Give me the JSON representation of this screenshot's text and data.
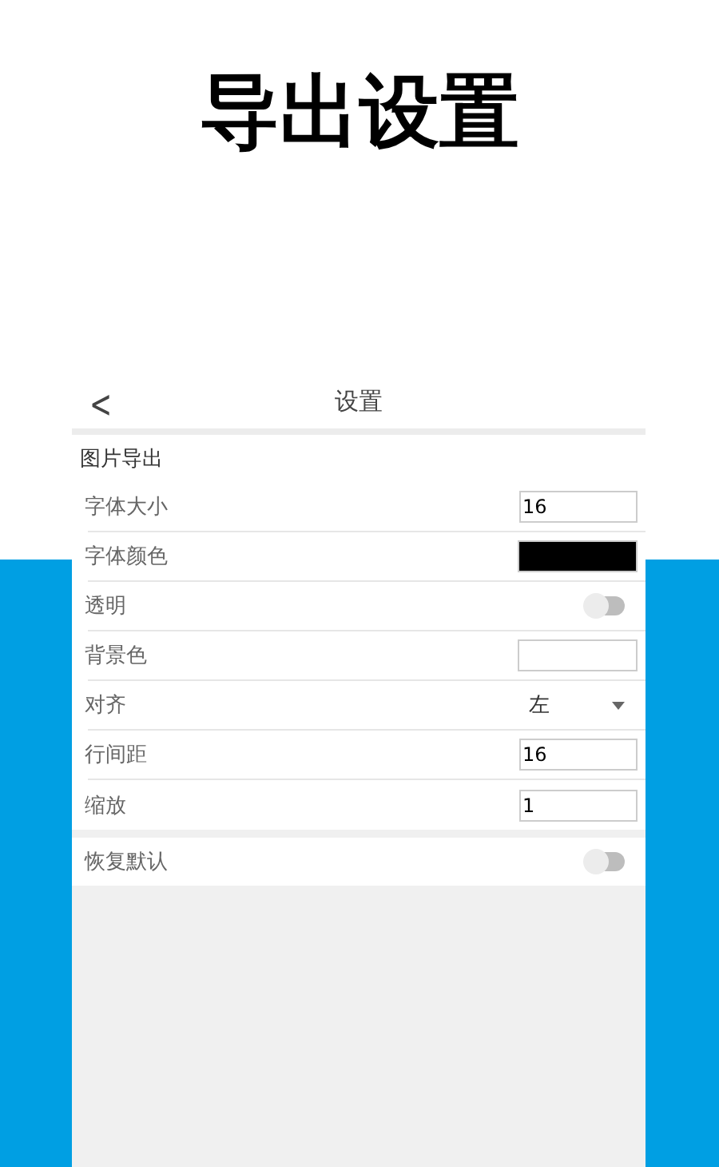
{
  "banner": {
    "title": "导出设置"
  },
  "header": {
    "back": "<",
    "title": "设置"
  },
  "section": {
    "title": "图片导出"
  },
  "rows": [
    {
      "kind": "number",
      "label": "字体大小",
      "value": "16"
    },
    {
      "kind": "color",
      "label": "字体颜色",
      "color": "#000000"
    },
    {
      "kind": "toggle",
      "label": "透明",
      "on": false
    },
    {
      "kind": "color",
      "label": "背景色",
      "color": "#ffffff"
    },
    {
      "kind": "select",
      "label": "对齐",
      "value": "左"
    },
    {
      "kind": "number",
      "label": "行间距",
      "value": "16"
    },
    {
      "kind": "number",
      "label": "缩放",
      "value": "1"
    }
  ],
  "reset": {
    "kind": "toggle",
    "label": "恢复默认",
    "on": false
  }
}
